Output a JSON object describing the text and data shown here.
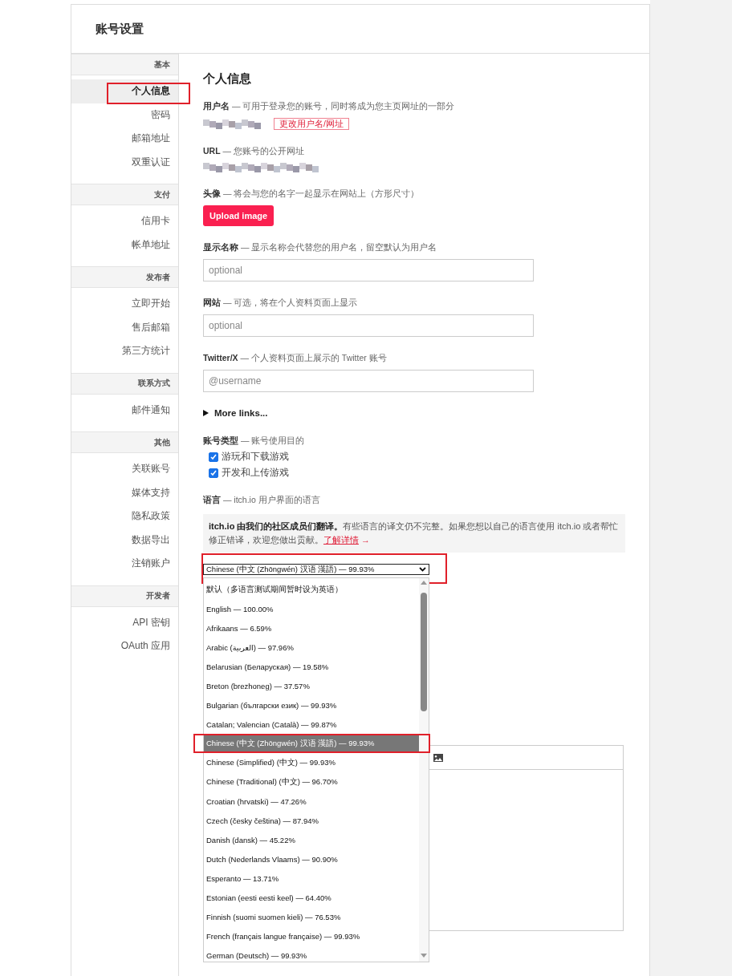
{
  "page": {
    "title": "账号设置"
  },
  "sidebar": {
    "sections": [
      {
        "heading": "基本",
        "items": [
          {
            "label": "个人信息",
            "selected": true,
            "highlighted": true
          },
          {
            "label": "密码",
            "selected": false,
            "highlighted": false
          },
          {
            "label": "邮箱地址",
            "selected": false,
            "highlighted": false
          },
          {
            "label": "双重认证",
            "selected": false,
            "highlighted": false
          }
        ]
      },
      {
        "heading": "支付",
        "items": [
          {
            "label": "信用卡",
            "selected": false,
            "highlighted": false
          },
          {
            "label": "帐单地址",
            "selected": false,
            "highlighted": false
          }
        ]
      },
      {
        "heading": "发布者",
        "items": [
          {
            "label": "立即开始",
            "selected": false,
            "highlighted": false
          },
          {
            "label": "售后邮箱",
            "selected": false,
            "highlighted": false
          },
          {
            "label": "第三方统计",
            "selected": false,
            "highlighted": false
          }
        ]
      },
      {
        "heading": "联系方式",
        "items": [
          {
            "label": "邮件通知",
            "selected": false,
            "highlighted": false
          }
        ]
      },
      {
        "heading": "其他",
        "items": [
          {
            "label": "关联账号",
            "selected": false,
            "highlighted": false
          },
          {
            "label": "媒体支持",
            "selected": false,
            "highlighted": false
          },
          {
            "label": "隐私政策",
            "selected": false,
            "highlighted": false
          },
          {
            "label": "数据导出",
            "selected": false,
            "highlighted": false
          },
          {
            "label": "注销账户",
            "selected": false,
            "highlighted": false
          }
        ]
      },
      {
        "heading": "开发者",
        "items": [
          {
            "label": "API 密钥",
            "selected": false,
            "highlighted": false
          },
          {
            "label": "OAuth 应用",
            "selected": false,
            "highlighted": false
          }
        ]
      }
    ]
  },
  "content": {
    "title": "个人信息",
    "fields": [
      {
        "kind": "username",
        "label": "**用户名** — 可用于登录您的账号，同时将成为您主页网址的一部分",
        "action": "更改用户名/网址"
      },
      {
        "kind": "url",
        "label": "**URL** — 您账号的公开网址"
      },
      {
        "kind": "upload",
        "label": "**头像** — 将会与您的名字一起显示在网站上（方形尺寸）",
        "button": "Upload image"
      },
      {
        "kind": "input",
        "label": "**显示名称** — 显示名称会代替您的用户名，留空默认为用户名",
        "placeholder": "optional"
      },
      {
        "kind": "input",
        "label": "**网站** — 可选，将在个人资料页面上显示",
        "placeholder": "optional"
      },
      {
        "kind": "input",
        "label": "**Twitter/X** — 个人资料页面上展示的 Twitter 账号",
        "placeholder": "@username"
      }
    ],
    "more_links": {
      "label": "More links...",
      "expanded": false
    },
    "account_type": {
      "label": "**账号类型** — 账号使用目的",
      "options": [
        {
          "label": "游玩和下载游戏",
          "checked": true
        },
        {
          "label": "开发和上传游戏",
          "checked": true
        }
      ]
    },
    "language": {
      "label": "**语言** — itch.io 用户界面的语言",
      "notice": {
        "text": "**itch.io 由我们的社区成员们翻译。**有些语言的译文仍不完整。如果您想以自己的语言使用 itch.io 或者帮忙修正错译，欢迎您做出贡献。",
        "link": "了解详情",
        "link_arrow": "→"
      },
      "select": {
        "value": "Chinese (中文 (Zhōngwén) 汉语 漢語) — 99.93%",
        "expanded": true,
        "highlighted": true
      },
      "options": [
        {
          "label": "默认（多语言测试期间暂时设为英语）",
          "selected": false,
          "highlighted": false
        },
        {
          "label": "English — 100.00%",
          "selected": false,
          "highlighted": false
        },
        {
          "label": "Afrikaans — 6.59%",
          "selected": false,
          "highlighted": false
        },
        {
          "label": "Arabic (العربية) — 97.96%",
          "selected": false,
          "highlighted": false
        },
        {
          "label": "Belarusian (Беларуская) — 19.58%",
          "selected": false,
          "highlighted": false
        },
        {
          "label": "Breton (brezhoneg) — 37.57%",
          "selected": false,
          "highlighted": false
        },
        {
          "label": "Bulgarian (български език) — 99.93%",
          "selected": false,
          "highlighted": false
        },
        {
          "label": "Catalan; Valencian (Català) — 99.87%",
          "selected": false,
          "highlighted": false
        },
        {
          "label": "Chinese (中文 (Zhōngwén) 汉语 漢語) — 99.93%",
          "selected": true,
          "highlighted": true
        },
        {
          "label": "Chinese (Simplified) (中文) — 99.93%",
          "selected": false,
          "highlighted": false
        },
        {
          "label": "Chinese (Traditional) (中文) — 96.70%",
          "selected": false,
          "highlighted": false
        },
        {
          "label": "Croatian (hrvatski) — 47.26%",
          "selected": false,
          "highlighted": false
        },
        {
          "label": "Czech (česky čeština) — 87.94%",
          "selected": false,
          "highlighted": false
        },
        {
          "label": "Danish (dansk) — 45.22%",
          "selected": false,
          "highlighted": false
        },
        {
          "label": "Dutch (Nederlands Vlaams) — 90.90%",
          "selected": false,
          "highlighted": false
        },
        {
          "label": "Esperanto — 13.71%",
          "selected": false,
          "highlighted": false
        },
        {
          "label": "Estonian (eesti eesti keel) — 64.40%",
          "selected": false,
          "highlighted": false
        },
        {
          "label": "Finnish (suomi suomen kieli) — 76.53%",
          "selected": false,
          "highlighted": false
        },
        {
          "label": "French (français langue française) — 99.93%",
          "selected": false,
          "highlighted": false
        },
        {
          "label": "German (Deutsch) — 99.93%",
          "selected": false,
          "highlighted": false
        }
      ]
    }
  }
}
